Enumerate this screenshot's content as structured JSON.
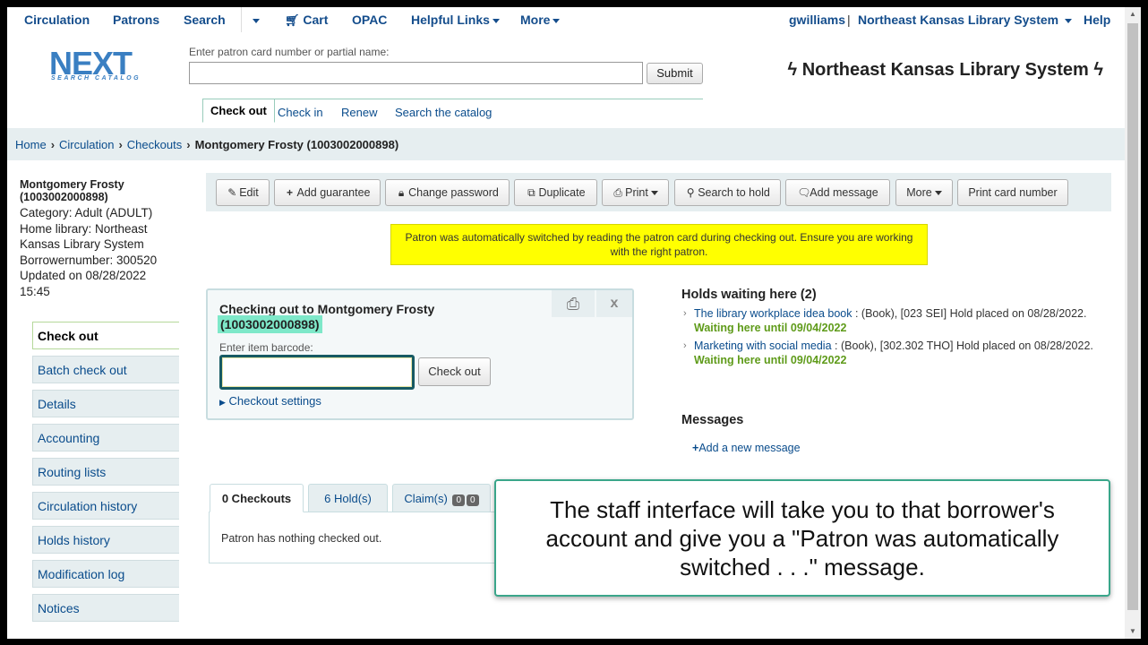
{
  "nav": {
    "circulation": "Circulation",
    "patrons": "Patrons",
    "search": "Search",
    "cart": "Cart",
    "opac": "OPAC",
    "helpful_links": "Helpful Links",
    "more": "More",
    "user": "gwilliams",
    "library": "Northeast Kansas Library System",
    "help": "Help"
  },
  "header": {
    "logo_big": "NEXT",
    "logo_small": "SEARCH CATALOG",
    "search_label": "Enter patron card number or partial name:",
    "search_value": "",
    "submit": "Submit",
    "subtabs": [
      "Check out",
      "Check in",
      "Renew",
      "Search the catalog"
    ],
    "library_title": "Northeast Kansas Library System"
  },
  "breadcrumb": [
    "Home",
    "Circulation",
    "Checkouts",
    "Montgomery Frosty (1003002000898)"
  ],
  "patron": {
    "name": "Montgomery Frosty (1003002000898)",
    "category": "Category: Adult (ADULT)",
    "home_library": "Home library: Northeast Kansas Library System",
    "borrowernumber": "Borrowernumber: 300520",
    "updated": "Updated on 08/28/2022 15:45"
  },
  "sidemenu": [
    "Check out",
    "Batch check out",
    "Details",
    "Accounting",
    "Routing lists",
    "Circulation history",
    "Holds history",
    "Modification log",
    "Notices"
  ],
  "toolbar": {
    "edit": "Edit",
    "add_guarantee": "Add guarantee",
    "change_password": "Change password",
    "duplicate": "Duplicate",
    "print": "Print",
    "search_to_hold": "Search to hold",
    "add_message": "Add message",
    "more": "More",
    "print_card_number": "Print card number"
  },
  "alert": "Patron was automatically switched by reading the patron card during checking out. Ensure you are working with the right patron.",
  "checkout": {
    "title": "Checking out to Montgomery Frosty",
    "cardnumber": "(1003002000898)",
    "barcode_label": "Enter item barcode:",
    "barcode_value": "",
    "button": "Check out",
    "settings": "Checkout settings"
  },
  "holds": {
    "title": "Holds waiting here (2)",
    "items": [
      {
        "link": "The library workplace idea book",
        "detail": ": (Book), [023 SEI] Hold placed on 08/28/2022.",
        "wait": "Waiting here until 09/04/2022"
      },
      {
        "link": "Marketing with social media",
        "detail": ": (Book), [302.302 THO] Hold placed on 08/28/2022.",
        "wait": "Waiting here until 09/04/2022"
      }
    ]
  },
  "messages": {
    "title": "Messages",
    "add": "Add a new message"
  },
  "tabs": {
    "checkouts": "0 Checkouts",
    "holds": "6 Hold(s)",
    "claims": "Claim(s)",
    "claims_badge1": "0",
    "claims_badge2": "0",
    "panel_text": "Patron has nothing checked out."
  },
  "callout": "The staff interface will take you to that borrower's account and give you a \"Patron was automatically switched . . .\" message."
}
